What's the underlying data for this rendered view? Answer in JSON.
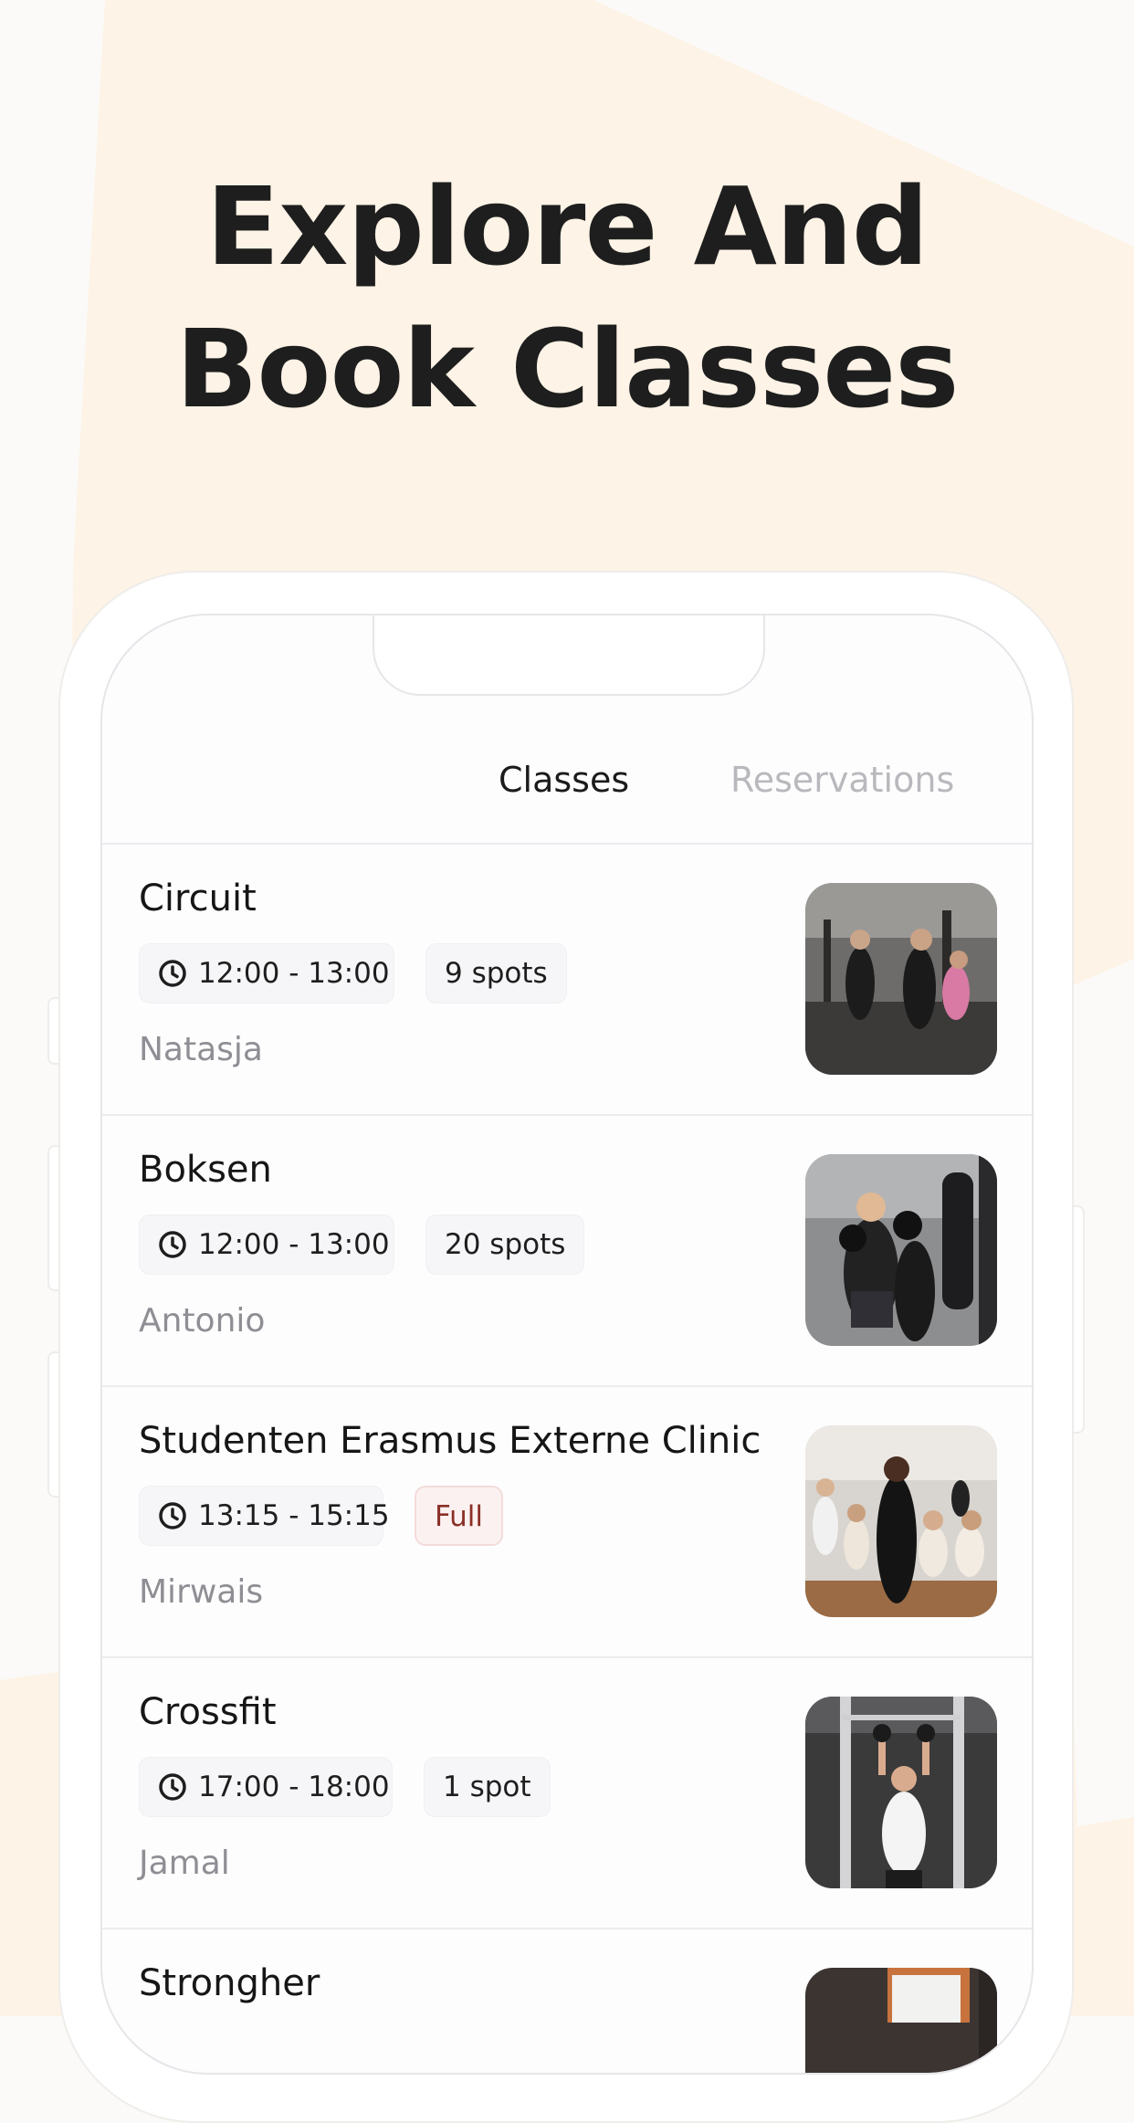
{
  "headline": {
    "line1": "Explore And",
    "line2": "Book Classes"
  },
  "colors": {
    "background": "#fbfaf8",
    "accent_shape": "#fdf3e6",
    "text": "#1e1e1e",
    "muted": "#8e8e94",
    "full_badge_text": "#8a3028",
    "full_badge_bg": "#fbf1f0"
  },
  "tabs": {
    "classes": "Classes",
    "reservations": "Reservations",
    "active": "Classes"
  },
  "classes": [
    {
      "title": "Circuit",
      "time": "12:00 - 13:00",
      "availability": "9 spots",
      "full": false,
      "instructor": "Natasja",
      "image": "gym-circuit-photo"
    },
    {
      "title": "Boksen",
      "time": "12:00 - 13:00",
      "availability": "20 spots",
      "full": false,
      "instructor": "Antonio",
      "image": "boxing-photo"
    },
    {
      "title": "Studenten Erasmus Externe Clinic",
      "time": "13:15 - 15:15",
      "availability": "Full",
      "full": true,
      "instructor": "Mirwais",
      "image": "group-clinic-photo"
    },
    {
      "title": "Crossfit",
      "time": "17:00 - 18:00",
      "availability": "1 spot",
      "full": false,
      "instructor": "Jamal",
      "image": "crossfit-photo"
    },
    {
      "title": "Strongher",
      "time": "",
      "availability": "",
      "full": false,
      "instructor": "",
      "image": "strongher-photo"
    }
  ]
}
